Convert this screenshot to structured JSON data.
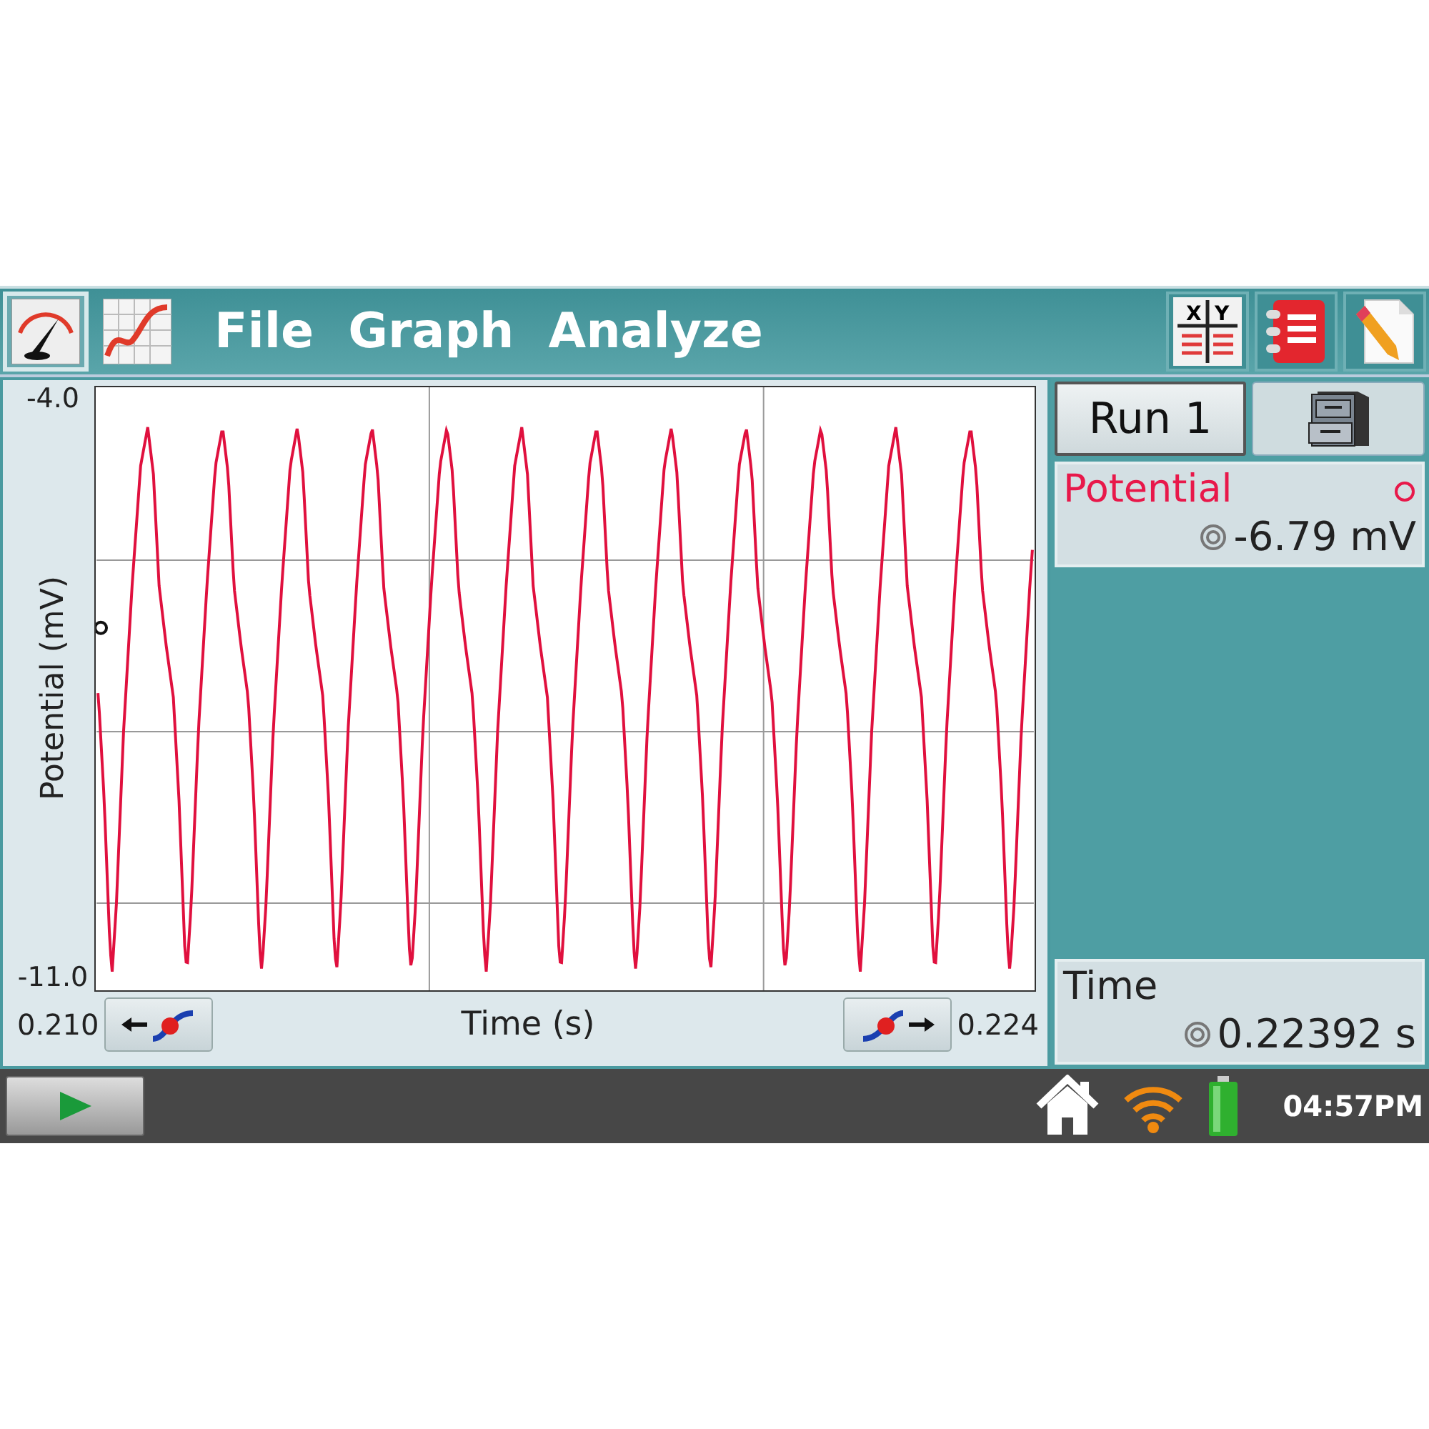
{
  "toolbar": {
    "views": [
      {
        "kind": "meter",
        "selected": true
      },
      {
        "kind": "graph",
        "selected": false
      }
    ],
    "menus": [
      "File",
      "Graph",
      "Analyze"
    ],
    "tools": [
      {
        "kind": "table",
        "columns": [
          "X",
          "Y"
        ]
      },
      {
        "kind": "notebook"
      },
      {
        "kind": "notes"
      }
    ]
  },
  "graph": {
    "y_axis_label": "Potential (mV)",
    "y_max": "-4.0",
    "y_min": "-11.0",
    "x_axis_label": "Time (s)",
    "x_min": "0.210",
    "x_max": "0.224"
  },
  "sidebar": {
    "run": "Run 1",
    "sensor": {
      "name": "Potential",
      "reading": "-6.79 mV"
    },
    "time": {
      "name": "Time",
      "reading": "0.22392 s"
    }
  },
  "taskbar": {
    "clock": "04:57PM"
  }
}
